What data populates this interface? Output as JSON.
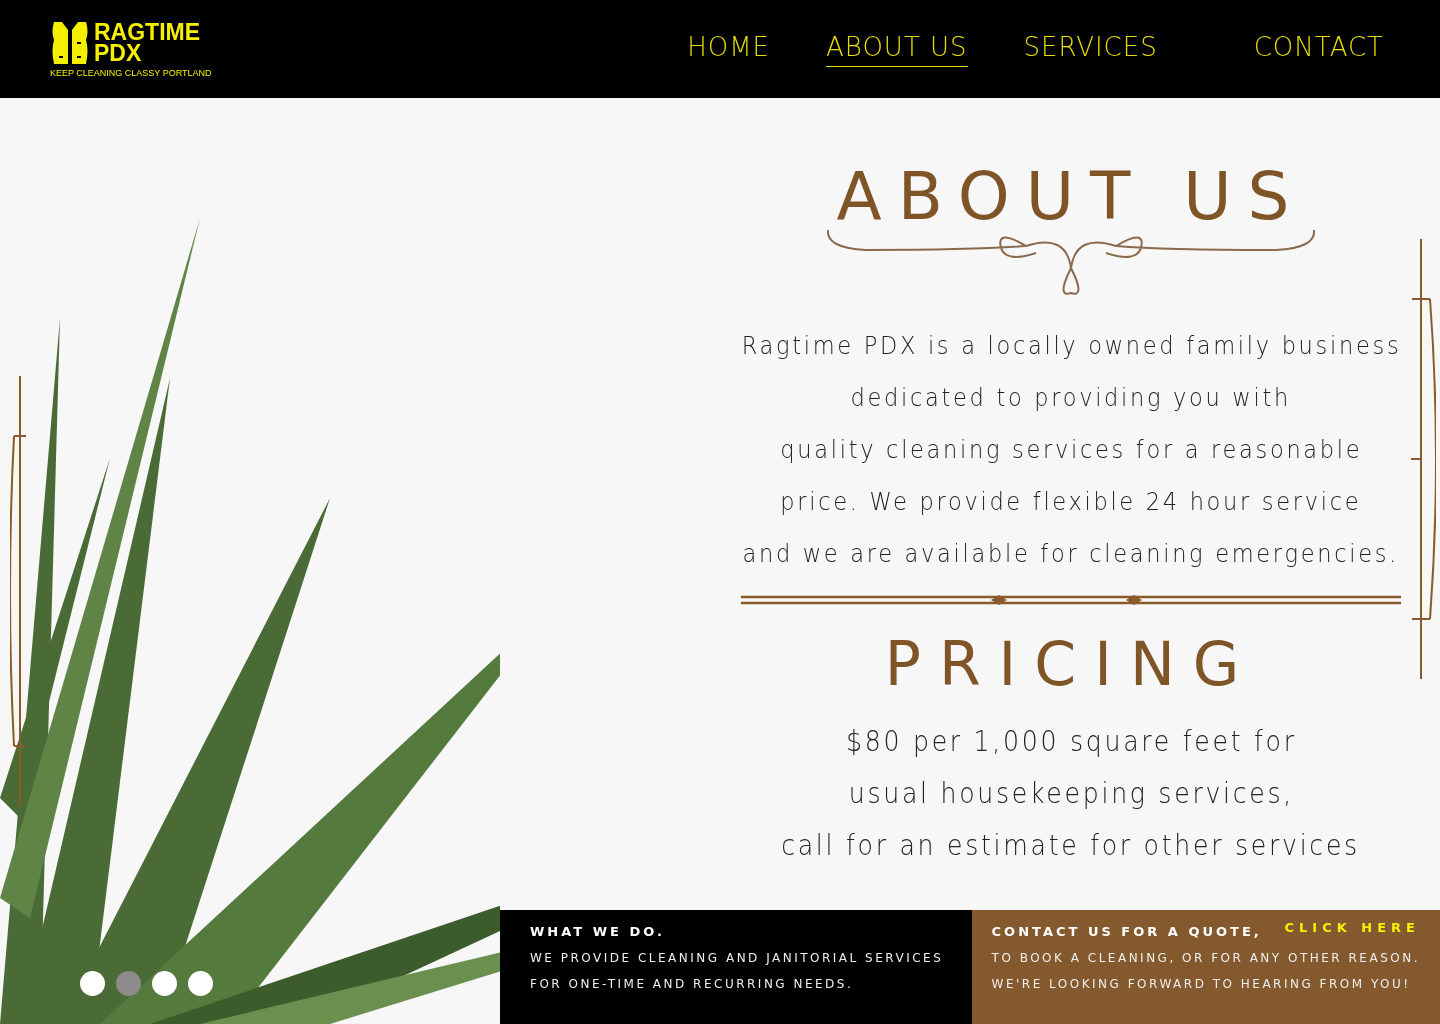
{
  "logo": {
    "name_line_1": "RAGTIME",
    "name_line_2": "PDX",
    "tagline": "KEEP CLEANING CLASSY PORTLAND"
  },
  "nav": [
    {
      "label": "HOME",
      "selected": false
    },
    {
      "label": "ABOUT US",
      "selected": true
    },
    {
      "label": "SERVICES",
      "selected": false
    },
    {
      "label": "CONTACT",
      "selected": false
    }
  ],
  "about": {
    "title": "ABOUT US",
    "lines": [
      "Ragtime PDX is a locally owned family business",
      "dedicated to providing you with",
      "quality cleaning services for a reasonable",
      "price. We provide flexible 24 hour service",
      "and we are available for cleaning emergencies."
    ]
  },
  "pricing": {
    "title": "PRICING",
    "lines": [
      "$80 per 1,000 square feet for",
      "usual housekeeping services,",
      "call for an estimate for other services"
    ]
  },
  "carousel_dots": [
    {
      "selected": false
    },
    {
      "selected": true
    },
    {
      "selected": false
    },
    {
      "selected": false
    }
  ],
  "footer": {
    "what_we_do": {
      "heading": "WHAT WE DO.",
      "lines": [
        "WE PROVIDE CLEANING AND JANITORIAL SERVICES",
        "FOR ONE-TIME AND RECURRING NEEDS."
      ]
    },
    "contact": {
      "heading": "CONTACT US FOR A QUOTE,",
      "link": "CLICK HERE",
      "lines": [
        "TO BOOK A CLEANING, OR FOR ANY OTHER REASON.",
        "WE'RE LOOKING FORWARD TO HEARING FROM YOU!"
      ]
    }
  }
}
